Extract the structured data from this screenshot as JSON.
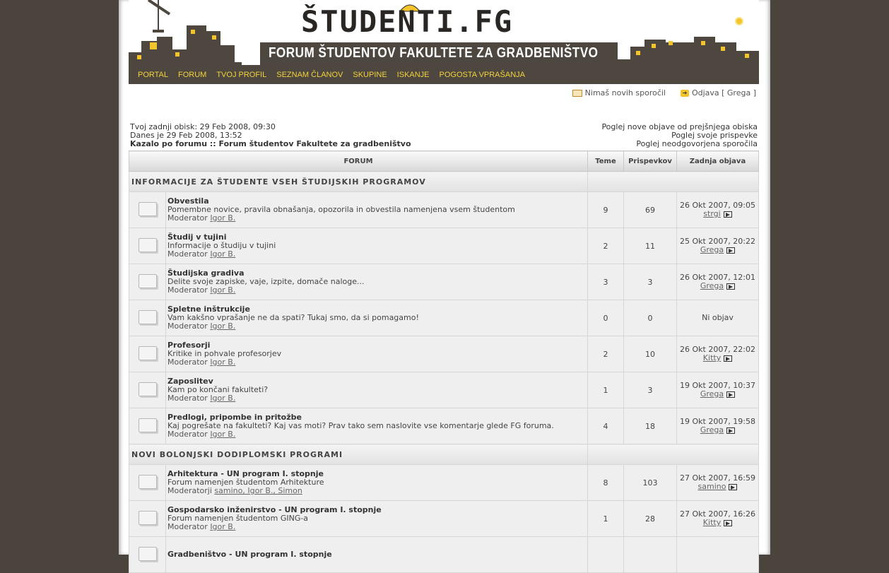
{
  "header": {
    "logo": "ŠTUDENTI.FG",
    "subtitle": "FORUM ŠTUDENTOV FAKULTETE ZA GRADBENIŠTVO"
  },
  "nav": [
    "PORTAL",
    "FORUM",
    "TVOJ PROFIL",
    "SEZNAM ČLANOV",
    "SKUPINE",
    "ISKANJE",
    "POGOSTA VPRAŠANJA"
  ],
  "userbar": {
    "messages": "Nimaš novih sporočil",
    "logout": "Odjava [ Grega ]"
  },
  "info": {
    "last_visit": "Tvoj zadnji obisk: 29 Feb 2008, 09:30",
    "now": "Danes je 29 Feb 2008, 13:52",
    "breadcrumb": "Kazalo po forumu :: Forum študentov Fakultete za gradbeništvo",
    "new_posts": "Poglej nove objave od prejšnjega obiska",
    "own_posts": "Poglej svoje prispevke",
    "unanswered": "Poglej neodgovorjena sporočila"
  },
  "table": {
    "headers": [
      "FORUM",
      "Teme",
      "Prispevkov",
      "Zadnja objava"
    ],
    "categories": [
      {
        "title": "INFORMACIJE ZA ŠTUDENTE VSEH ŠTUDIJSKIH PROGRAMOV",
        "forums": [
          {
            "name": "Obvestila",
            "desc": "Pomembne novice, pravila obnašanja, opozorila in obvestila namenjena vsem študentom",
            "mod_label": "Moderator",
            "mods": "Igor B.",
            "topics": "9",
            "posts": "69",
            "last_date": "26 Okt 2007, 09:05",
            "last_user": "strgi"
          },
          {
            "name": "Študij v tujini",
            "desc": "Informacije o študiju v tujini",
            "mod_label": "Moderator",
            "mods": "Igor B.",
            "topics": "2",
            "posts": "11",
            "last_date": "25 Okt 2007, 20:22",
            "last_user": "Grega"
          },
          {
            "name": "Študijska gradiva",
            "desc": "Delite svoje zapiske, vaje, izpite, domače naloge...",
            "mod_label": "Moderator",
            "mods": "Igor B.",
            "topics": "3",
            "posts": "3",
            "last_date": "26 Okt 2007, 12:01",
            "last_user": "Grega"
          },
          {
            "name": "Spletne inštrukcije",
            "desc": "Vam kakšno vprašanje ne da spati? Tukaj smo, da si pomagamo!",
            "mod_label": "Moderator",
            "mods": "Igor B.",
            "topics": "0",
            "posts": "0",
            "last_date": "Ni objav",
            "last_user": ""
          },
          {
            "name": "Profesorji",
            "desc": "Kritike in pohvale profesorjev",
            "mod_label": "Moderator",
            "mods": "Igor B.",
            "topics": "2",
            "posts": "10",
            "last_date": "26 Okt 2007, 22:02",
            "last_user": "Kitty"
          },
          {
            "name": "Zaposlitev",
            "desc": "Kam po končani fakulteti?",
            "mod_label": "Moderator",
            "mods": "Igor B.",
            "topics": "1",
            "posts": "3",
            "last_date": "19 Okt 2007, 10:37",
            "last_user": "Grega"
          },
          {
            "name": "Predlogi, pripombe in pritožbe",
            "desc": "Kaj pogrešate na fakulteti? Kaj vas moti? Prav tako sem naslovite vse komentarje glede FG foruma.",
            "mod_label": "Moderator",
            "mods": "Igor B.",
            "topics": "4",
            "posts": "18",
            "last_date": "19 Okt 2007, 19:58",
            "last_user": "Grega"
          }
        ]
      },
      {
        "title": "NOVI BOLONJSKI DODIPLOMSKI PROGRAMI",
        "forums": [
          {
            "name": "Arhitektura - UN program I. stopnje",
            "desc": "Forum namenjen študentom Arhitekture",
            "mod_label": "Moderatorji",
            "mods": "samino, Igor B., Simon",
            "topics": "8",
            "posts": "103",
            "last_date": "27 Okt 2007, 16:59",
            "last_user": "samino"
          },
          {
            "name": "Gospodarsko inženirstvo - UN program I. stopnje",
            "desc": "Forum namenjen študentom GING-a",
            "mod_label": "Moderator",
            "mods": "Igor B.",
            "topics": "1",
            "posts": "28",
            "last_date": "27 Okt 2007, 16:26",
            "last_user": "Kitty"
          },
          {
            "name": "Gradbeništvo - UN program I. stopnje",
            "desc": "",
            "mod_label": "",
            "mods": "",
            "topics": "",
            "posts": "",
            "last_date": "",
            "last_user": ""
          }
        ]
      }
    ]
  }
}
